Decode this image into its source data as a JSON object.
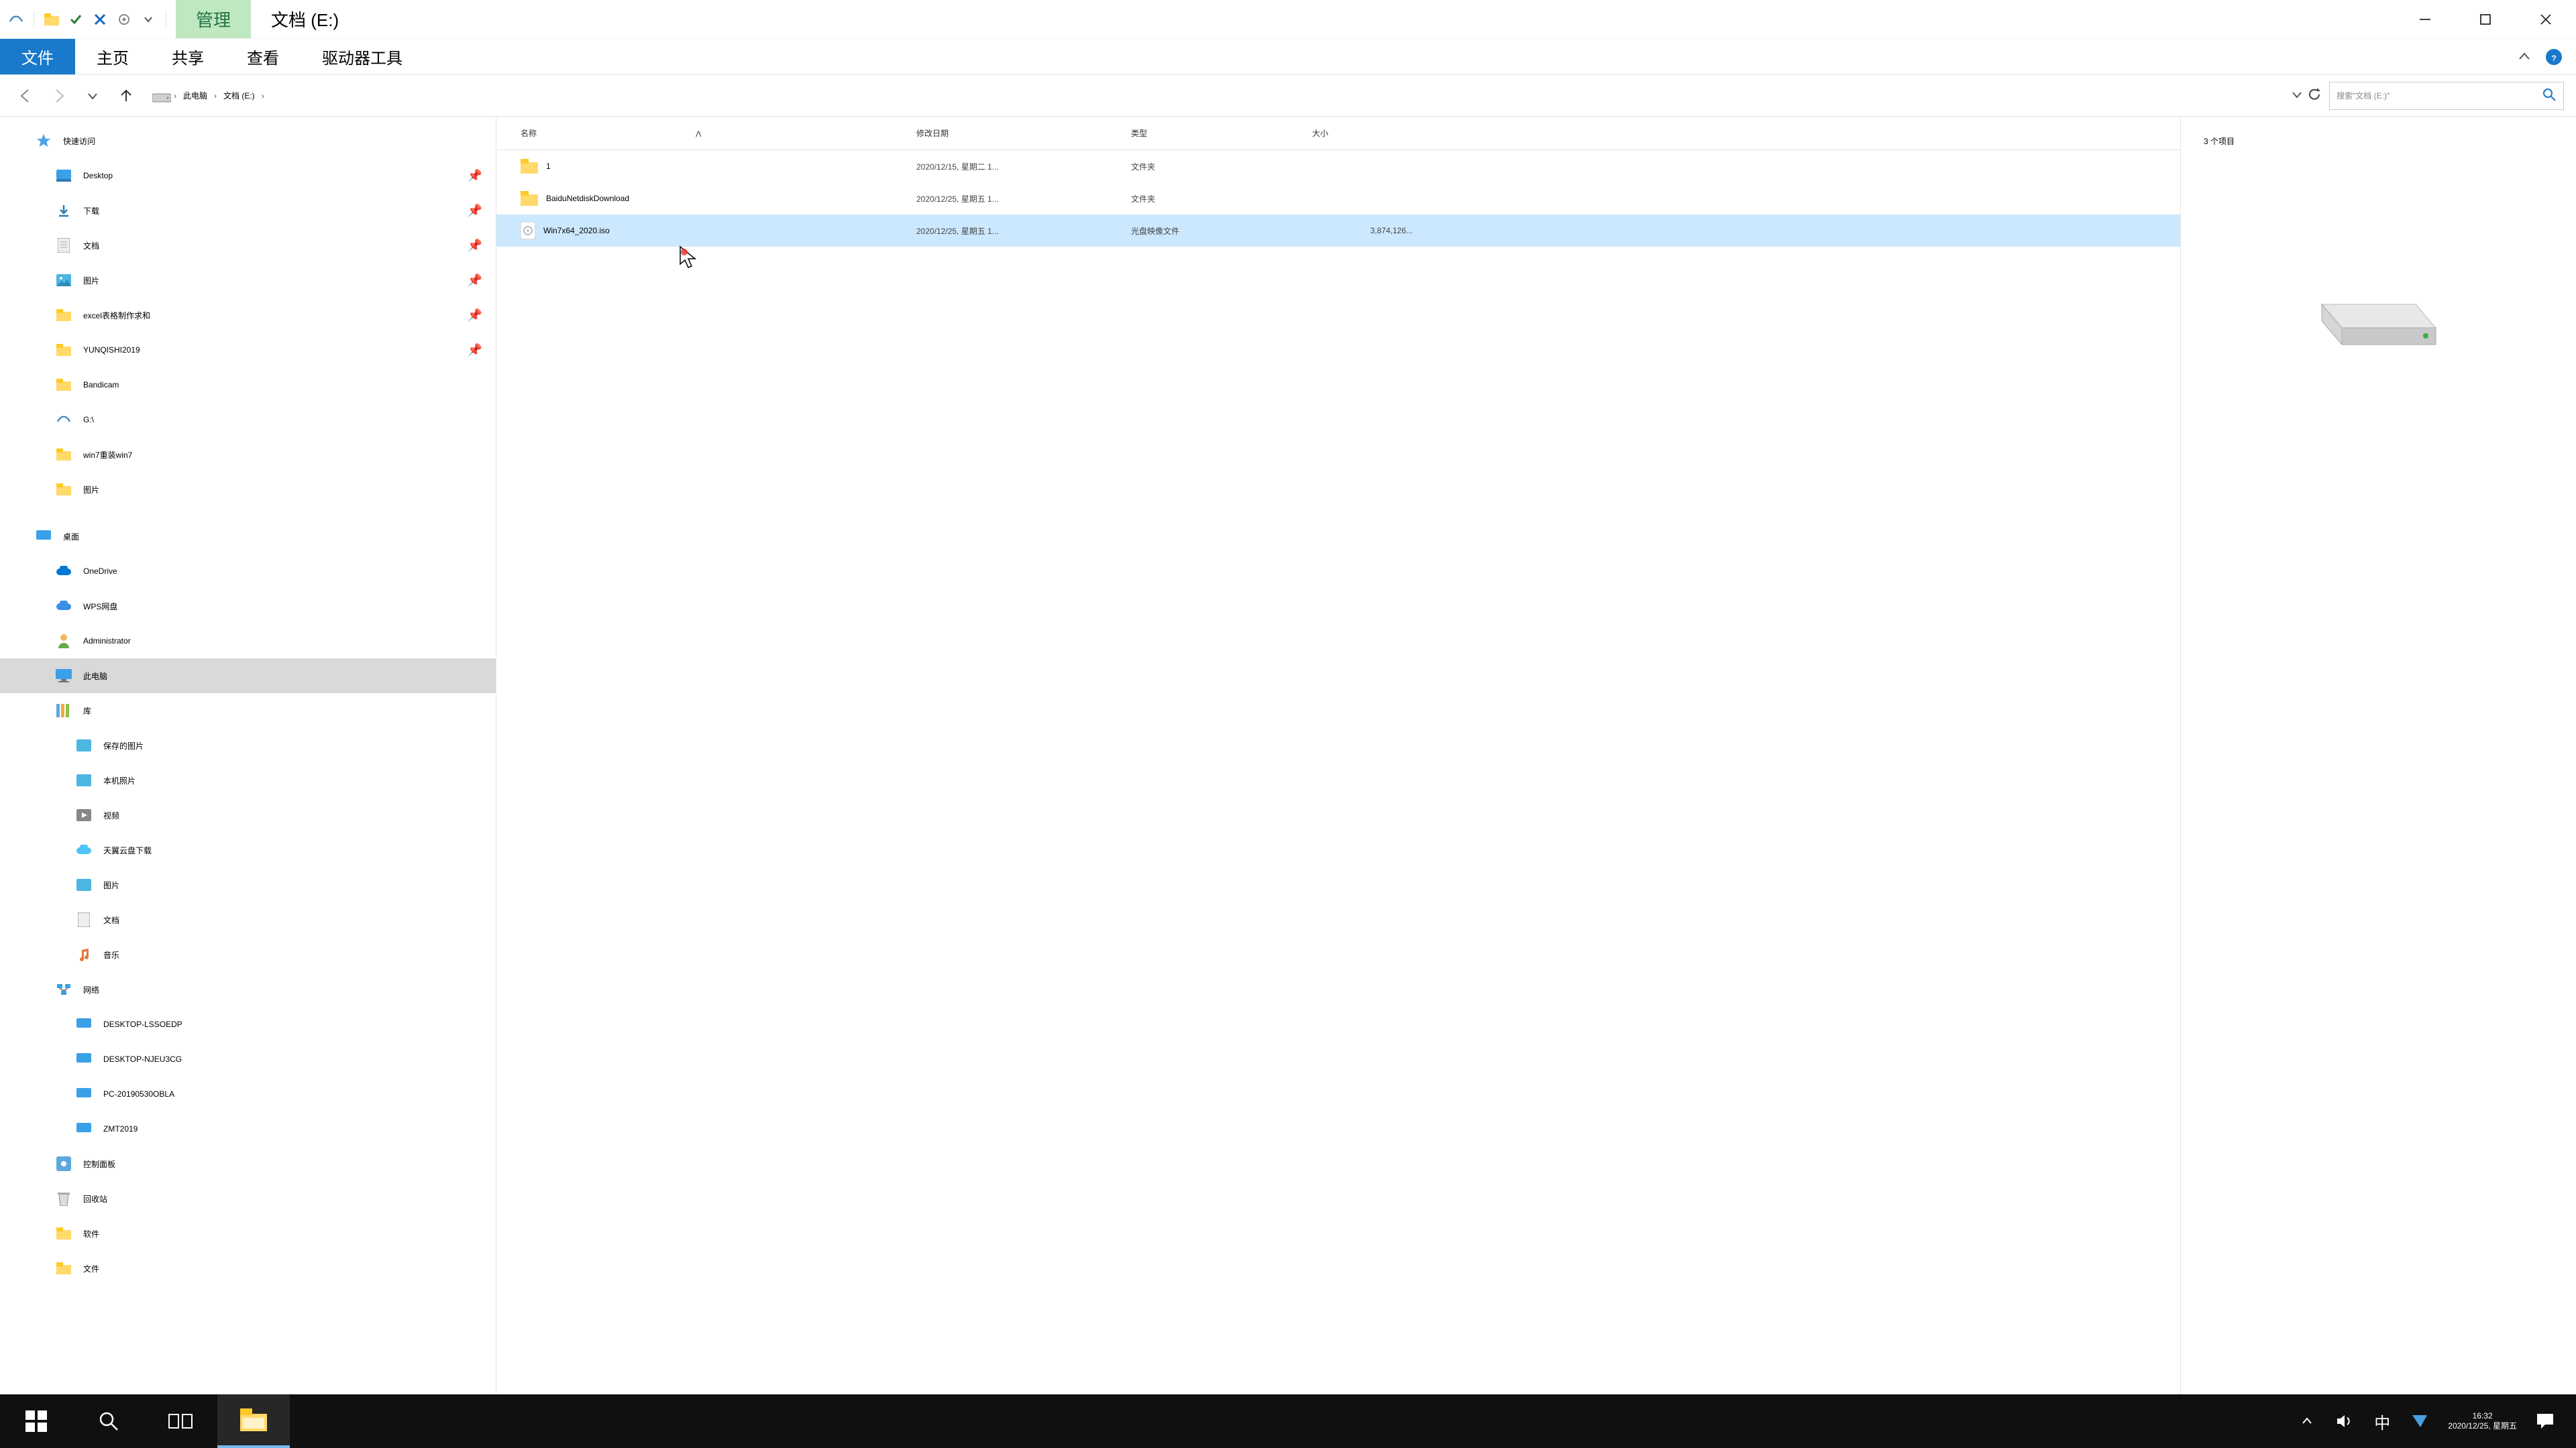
{
  "titlebar": {
    "contextual_tab": "管理",
    "location_tab": "文档 (E:)"
  },
  "ribbon": {
    "tabs": {
      "file": "文件",
      "home": "主页",
      "share": "共享",
      "view": "查看",
      "drive": "驱动器工具"
    }
  },
  "breadcrumbs": {
    "root": "此电脑",
    "current": "文档 (E:)"
  },
  "search": {
    "placeholder": "搜索\"文档 (E:)\""
  },
  "tree": {
    "quick_access": "快速访问",
    "desktop": "Desktop",
    "downloads": "下载",
    "documents": "文档",
    "pictures": "图片",
    "excel": "excel表格制作求和",
    "yunqishi": "YUNQISHI2019",
    "bandicam": "Bandicam",
    "gdrive": "G:\\",
    "win7": "win7重装win7",
    "pictures2": "图片",
    "desktop_group": "桌面",
    "onedrive": "OneDrive",
    "wps": "WPS网盘",
    "admin": "Administrator",
    "thispc": "此电脑",
    "library": "库",
    "saved_pictures": "保存的图片",
    "camera_roll": "本机照片",
    "videos": "视频",
    "tianyi": "天翼云盘下载",
    "pictures3": "图片",
    "documents2": "文档",
    "music": "音乐",
    "network": "网络",
    "pc1": "DESKTOP-LSSOEDP",
    "pc2": "DESKTOP-NJEU3CG",
    "pc3": "PC-20190530OBLA",
    "pc4": "ZMT2019",
    "control_panel": "控制面板",
    "recycle": "回收站",
    "software": "软件",
    "files": "文件"
  },
  "columns": {
    "name": "名称",
    "date": "修改日期",
    "type": "类型",
    "size": "大小"
  },
  "rows": [
    {
      "name": "1",
      "date": "2020/12/15, 星期二 1...",
      "type": "文件夹",
      "size": ""
    },
    {
      "name": "BaiduNetdiskDownload",
      "date": "2020/12/25, 星期五 1...",
      "type": "文件夹",
      "size": ""
    },
    {
      "name": "Win7x64_2020.iso",
      "date": "2020/12/25, 星期五 1...",
      "type": "光盘映像文件",
      "size": "3,874,126..."
    }
  ],
  "preview": {
    "count_label": "3 个项目"
  },
  "statusbar": {
    "left": "3 个项目"
  },
  "taskbar": {
    "time": "16:32",
    "date": "2020/12/25, 星期五",
    "ime": "中"
  }
}
